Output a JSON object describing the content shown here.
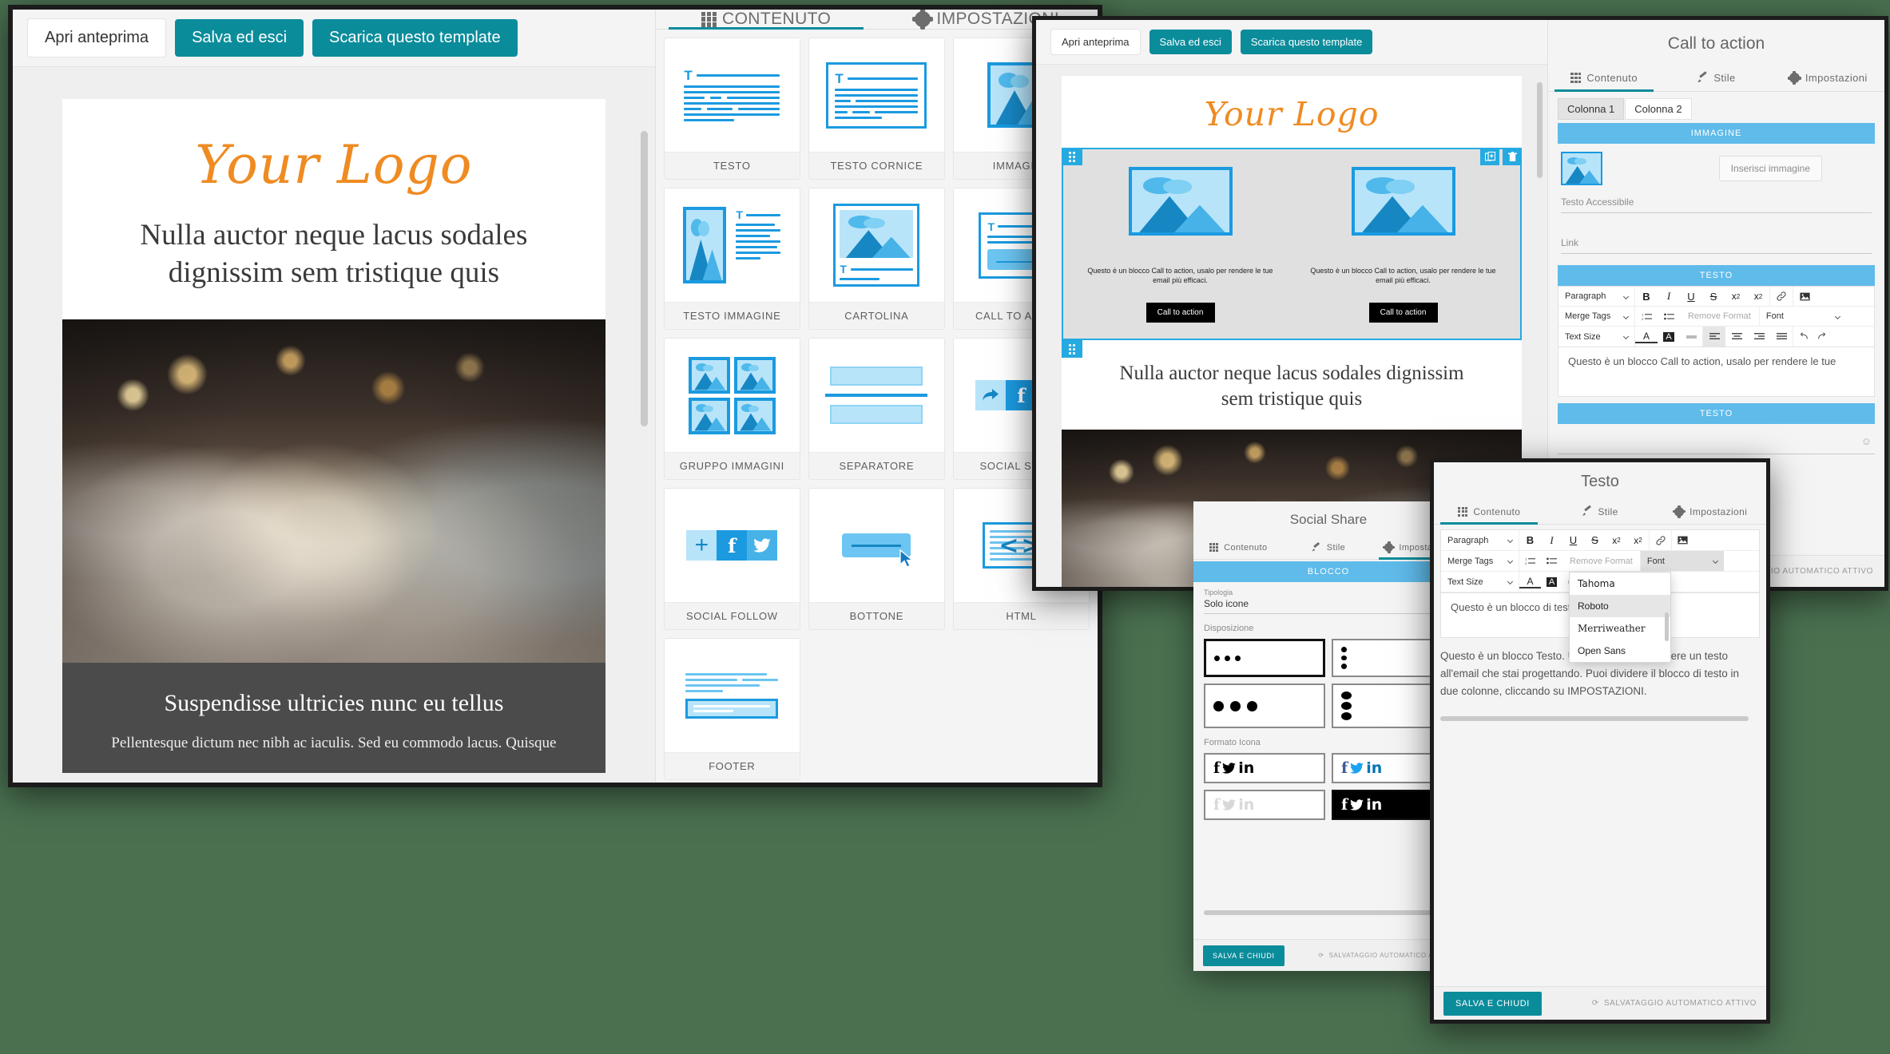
{
  "app": {
    "toolbar": {
      "preview": "Apri anteprima",
      "save_exit": "Salva ed esci",
      "download": "Scarica questo template"
    },
    "accent_teal": "#0b8c9b",
    "accent_blue": "#25aae1",
    "logo_orange": "#ef8b22"
  },
  "email": {
    "logo": "Your Logo",
    "headline": "Nulla auctor neque lacus sodales dignissim sem tristique quis",
    "band_title": "Suspendisse ultricies nunc eu tellus",
    "band_text": "Pellentesque dictum nec nibh ac iaculis. Sed eu commodo lacus. Quisque"
  },
  "content_panel": {
    "tabs": [
      {
        "label": "CONTENUTO",
        "icon": "grid-icon",
        "active": true
      },
      {
        "label": "IMPOSTAZIONI",
        "icon": "gear-icon",
        "active": false
      }
    ],
    "blocks": [
      {
        "label": "TESTO",
        "art": "text"
      },
      {
        "label": "TESTO CORNICE",
        "art": "text-framed"
      },
      {
        "label": "IMMAGINE",
        "art": "image"
      },
      {
        "label": "TESTO IMMAGINE",
        "art": "text-image"
      },
      {
        "label": "CARTOLINA",
        "art": "postcard"
      },
      {
        "label": "CALL TO ACTION",
        "art": "cta"
      },
      {
        "label": "GRUPPO IMMAGINI",
        "art": "image-group"
      },
      {
        "label": "SEPARATORE",
        "art": "separator"
      },
      {
        "label": "SOCIAL SHARE",
        "art": "social-share"
      },
      {
        "label": "SOCIAL FOLLOW",
        "art": "social-follow"
      },
      {
        "label": "BOTTONE",
        "art": "button"
      },
      {
        "label": "HTML",
        "art": "html"
      },
      {
        "label": "FOOTER",
        "art": "footer"
      }
    ]
  },
  "cta_window": {
    "title": "Call to action",
    "tabs": [
      {
        "label": "Contenuto",
        "icon": "grid-icon",
        "active": true
      },
      {
        "label": "Stile",
        "icon": "brush-icon",
        "active": false
      },
      {
        "label": "Impostazioni",
        "icon": "gear-icon",
        "active": false
      }
    ],
    "column_tabs": [
      {
        "label": "Colonna 1",
        "active": true
      },
      {
        "label": "Colonna 2",
        "active": false
      }
    ],
    "image_section": "IMMAGINE",
    "insert_image": "Inserisci immagine",
    "alt_label": "Testo Accessibile",
    "alt_value": "",
    "link_label": "Link",
    "link_value": "",
    "text_section": "TESTO",
    "editor_text": "Questo è un blocco Call to action, usalo per rendere le tue",
    "autosave": "SALVATAGGIO AUTOMATICO ATTIVO",
    "canvas": {
      "cta_text": "Questo è un blocco Call to action, usalo per rendere le tue email più efficaci.",
      "cta_button": "Call to action"
    }
  },
  "rich_toolbar": {
    "paragraph": "Paragraph",
    "merge_tags": "Merge Tags",
    "text_size": "Text Size",
    "remove_format": "Remove Format",
    "font": "Font",
    "icons": {
      "bold": "B",
      "italic": "I",
      "underline": "U",
      "strike": "S",
      "superscript": "x²",
      "subscript": "x₂",
      "link": "link-icon",
      "image": "image-icon",
      "ordered_list": "ordered-list-icon",
      "bullet_list": "bullet-list-icon",
      "text_color": "text-color-icon",
      "highlight": "highlight-icon",
      "hr": "horizontal-rule-icon",
      "align_left": "align-left-icon",
      "align_center": "align-center-icon",
      "align_right": "align-right-icon",
      "align_justify": "align-justify-icon",
      "undo": "undo-icon",
      "redo": "redo-icon"
    }
  },
  "social_window": {
    "title": "Social Share",
    "tabs": [
      {
        "label": "Contenuto",
        "icon": "grid-icon",
        "active": false
      },
      {
        "label": "Stile",
        "icon": "brush-icon",
        "active": false
      },
      {
        "label": "Impostazioni",
        "icon": "gear-icon",
        "active": true
      }
    ],
    "section": "BLOCCO",
    "type_label": "Tipologia",
    "type_value": "Solo icone",
    "layout_label": "Disposizione",
    "icon_format_label": "Formato Icona",
    "save_close": "SALVA E CHIUDI",
    "autosave": "SALVATAGGIO AUTOMATICO ATTIVO"
  },
  "text_window": {
    "title": "Testo",
    "tabs": [
      {
        "label": "Contenuto",
        "icon": "grid-icon",
        "active": true
      },
      {
        "label": "Stile",
        "icon": "brush-icon",
        "active": false
      },
      {
        "label": "Impostazioni",
        "icon": "gear-icon",
        "active": false
      }
    ],
    "editor_preview": "Questo è un blocco di testo. Usalo per email.",
    "body_text": "Questo è un blocco Testo. Utilizzalo per aggiungere un testo all'email che stai progettando. Puoi dividere il blocco di testo in due colonne, cliccando su IMPOSTAZIONI.",
    "font_dropdown": {
      "label": "Font",
      "options": [
        {
          "label": "Tahoma",
          "highlighted": false
        },
        {
          "label": "Roboto",
          "highlighted": true
        },
        {
          "label": "Merriweather",
          "highlighted": false
        },
        {
          "label": "Open Sans",
          "highlighted": false
        }
      ]
    },
    "save_close": "SALVA E CHIUDI",
    "autosave": "SALVATAGGIO AUTOMATICO ATTIVO"
  }
}
